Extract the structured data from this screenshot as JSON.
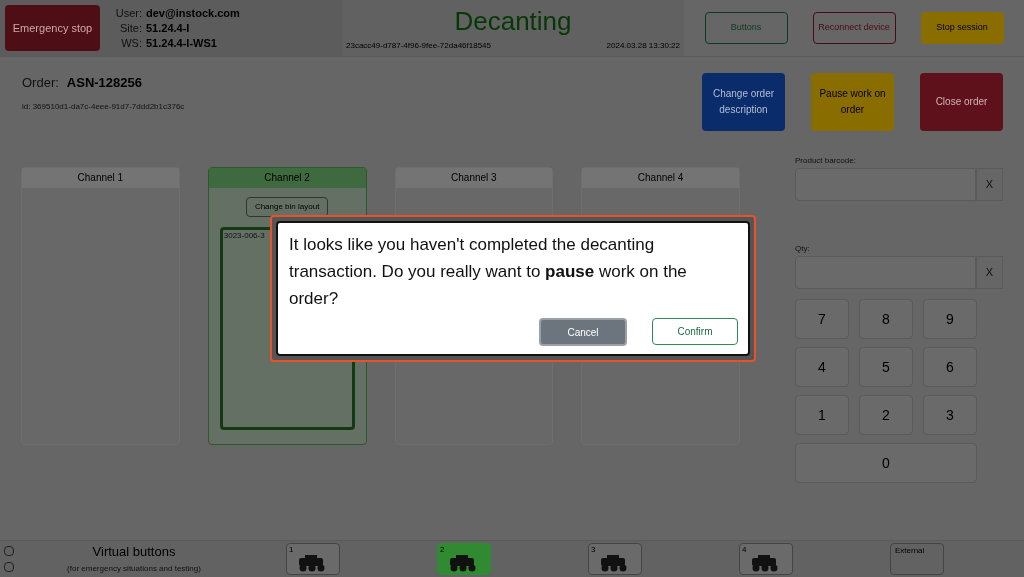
{
  "header": {
    "emergency_button": "Emergency stop",
    "user_info": [
      {
        "label": "User:",
        "value": "dev@instock.com"
      },
      {
        "label": "Site:",
        "value": "51.24.4-I"
      },
      {
        "label": "WS:",
        "value": "51.24.4-I-WS1"
      }
    ],
    "title": "Decanting",
    "session_id": "23cacc49-d787-4f96-9fee-72da46f18545",
    "datetime": "2024.03.28 13:30:22",
    "buttons": [
      {
        "label": "Buttons",
        "kind": "outline-green"
      },
      {
        "label": "Reconnect device",
        "kind": "outline-red"
      },
      {
        "label": "Stop session",
        "kind": "yellow"
      }
    ]
  },
  "order": {
    "label": "Order:",
    "number": "ASN-128256",
    "id": "id: 369510d1-da7c-4eee-91d7-7ddd2b1c376c"
  },
  "order_actions": [
    {
      "label": "Change order description",
      "kind": "blue"
    },
    {
      "label": "Pause work on order",
      "kind": "yellow"
    },
    {
      "label": "Close order",
      "kind": "red"
    }
  ],
  "channels": [
    {
      "title": "Channel 1",
      "selected": false
    },
    {
      "title": "Channel 2",
      "selected": true,
      "layout_button": "Change bin layout",
      "bin_label": "3023-006-3"
    },
    {
      "title": "Channel 3",
      "selected": false
    },
    {
      "title": "Channel 4",
      "selected": false
    }
  ],
  "inputs": [
    {
      "label": "Product barcode:",
      "clear": "X"
    },
    {
      "label": "Qty:",
      "clear": "X"
    }
  ],
  "keypad": [
    "7",
    "8",
    "9",
    "4",
    "5",
    "6",
    "1",
    "2",
    "3",
    "0"
  ],
  "bottom_bar": {
    "title": "Virtual buttons",
    "subtitle": "(for emergency situations and testing)",
    "robots": [
      {
        "label": "1",
        "selected": false
      },
      {
        "label": "2",
        "selected": true
      },
      {
        "label": "3",
        "selected": false
      },
      {
        "label": "4",
        "selected": false
      }
    ],
    "external": "External"
  },
  "dialog": {
    "message": "It looks like you haven't completed the decanting transaction. Do you really want to **pause** work on the order?",
    "cancel": "Cancel",
    "confirm": "Confirm"
  }
}
